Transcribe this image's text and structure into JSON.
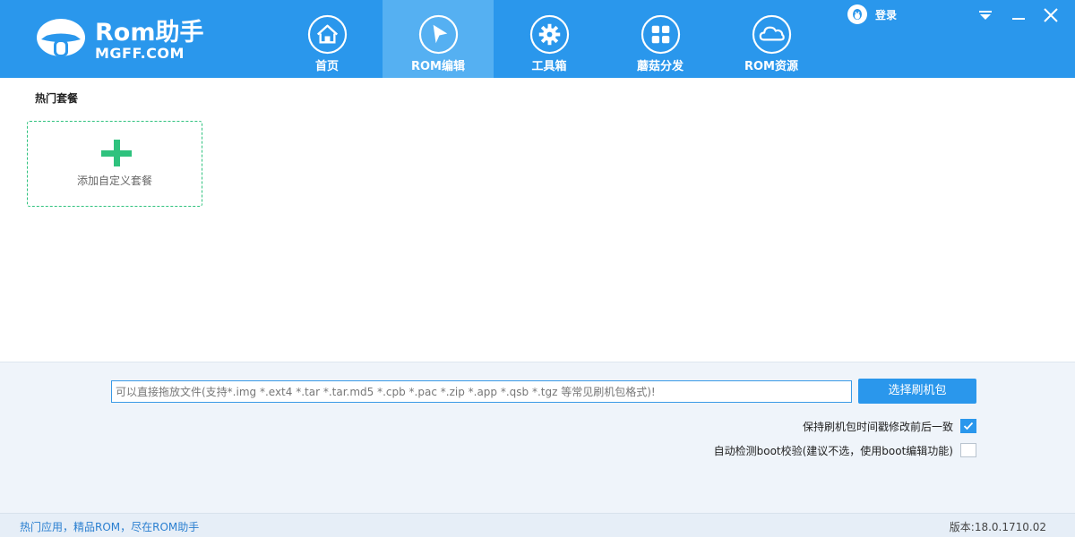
{
  "app": {
    "logo_title": "Rom助手",
    "logo_sub": "MGFF.COM"
  },
  "nav": {
    "items": [
      {
        "label": "首页",
        "icon": "home-icon"
      },
      {
        "label": "ROM编辑",
        "icon": "cursor-arrow-icon",
        "active": true
      },
      {
        "label": "工具箱",
        "icon": "gear-icon"
      },
      {
        "label": "蘑菇分发",
        "icon": "grid-icon"
      },
      {
        "label": "ROM资源",
        "icon": "cloud-icon"
      }
    ]
  },
  "login": {
    "label": "登录",
    "icon": "qq-penguin-icon"
  },
  "window_controls": [
    "dropdown-icon",
    "minimize-icon",
    "close-icon"
  ],
  "main": {
    "section_title": "热门套餐",
    "add_card_label": "添加自定义套餐"
  },
  "flash": {
    "input_placeholder": "可以直接拖放文件(支持*.img *.ext4 *.tar *.tar.md5 *.cpb *.pac *.zip *.app *.qsb *.tgz 等常见刷机包格式)!",
    "choose_button": "选择刷机包",
    "options": [
      {
        "label": "保持刷机包时间戳修改前后一致",
        "checked": true
      },
      {
        "label": "自动检测boot校验(建议不选，使用boot编辑功能)",
        "checked": false
      }
    ]
  },
  "status": {
    "left": "热门应用，精品ROM，尽在ROM助手",
    "version": "版本:18.0.1710.02"
  },
  "colors": {
    "brand": "#2a97ec",
    "nav_active": "#55b0f2",
    "accent_green": "#2fc27e",
    "bottom_bg": "#eff4fa"
  }
}
